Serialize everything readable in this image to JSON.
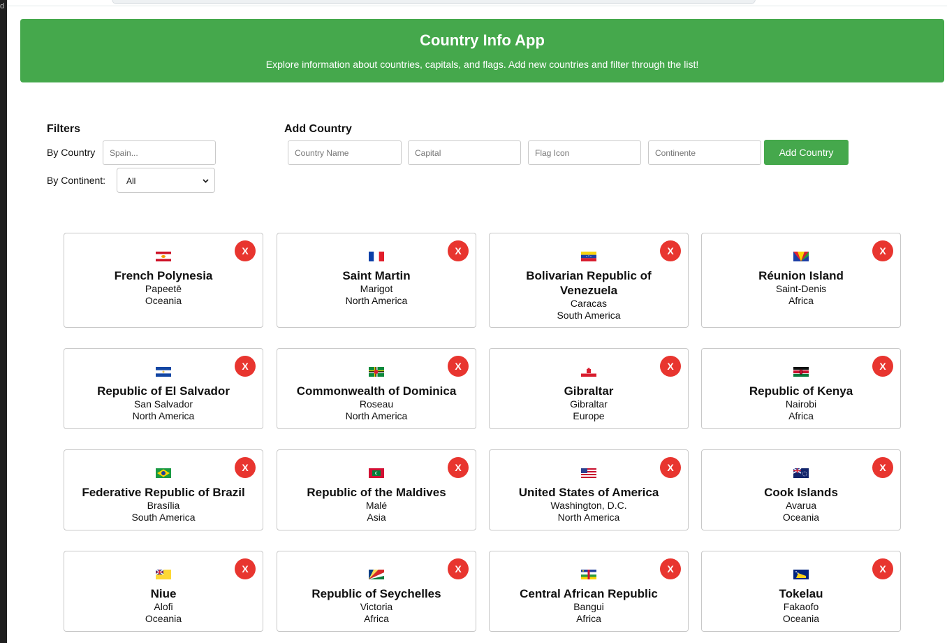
{
  "header": {
    "title": "Country Info App",
    "subtitle": "Explore information about countries, capitals, and flags. Add new countries and filter through the list!"
  },
  "filters": {
    "title": "Filters",
    "by_country_label": "By Country",
    "country_placeholder": "Spain...",
    "by_continent_label": "By Continent:",
    "continent_selected": "All"
  },
  "add_country": {
    "title": "Add Country",
    "name_placeholder": "Country Name",
    "capital_placeholder": "Capital",
    "flag_placeholder": "Flag Icon",
    "continent_placeholder": "Continente",
    "button_label": "Add Country"
  },
  "delete_label": "X",
  "countries": [
    {
      "name": "French Polynesia",
      "capital": "Papeetē",
      "continent": "Oceania",
      "flag_icon": "french-polynesia-flag-icon"
    },
    {
      "name": "Saint Martin",
      "capital": "Marigot",
      "continent": "North America",
      "flag_icon": "saint-martin-flag-icon"
    },
    {
      "name": "Bolivarian Republic of Venezuela",
      "capital": "Caracas",
      "continent": "South America",
      "flag_icon": "venezuela-flag-icon"
    },
    {
      "name": "Réunion Island",
      "capital": "Saint-Denis",
      "continent": "Africa",
      "flag_icon": "reunion-flag-icon"
    },
    {
      "name": "Republic of El Salvador",
      "capital": "San Salvador",
      "continent": "North America",
      "flag_icon": "el-salvador-flag-icon"
    },
    {
      "name": "Commonwealth of Dominica",
      "capital": "Roseau",
      "continent": "North America",
      "flag_icon": "dominica-flag-icon"
    },
    {
      "name": "Gibraltar",
      "capital": "Gibraltar",
      "continent": "Europe",
      "flag_icon": "gibraltar-flag-icon"
    },
    {
      "name": "Republic of Kenya",
      "capital": "Nairobi",
      "continent": "Africa",
      "flag_icon": "kenya-flag-icon"
    },
    {
      "name": "Federative Republic of Brazil",
      "capital": "Brasília",
      "continent": "South America",
      "flag_icon": "brazil-flag-icon"
    },
    {
      "name": "Republic of the Maldives",
      "capital": "Malé",
      "continent": "Asia",
      "flag_icon": "maldives-flag-icon"
    },
    {
      "name": "United States of America",
      "capital": "Washington, D.C.",
      "continent": "North America",
      "flag_icon": "usa-flag-icon"
    },
    {
      "name": "Cook Islands",
      "capital": "Avarua",
      "continent": "Oceania",
      "flag_icon": "cook-islands-flag-icon"
    },
    {
      "name": "Niue",
      "capital": "Alofi",
      "continent": "Oceania",
      "flag_icon": "niue-flag-icon"
    },
    {
      "name": "Republic of Seychelles",
      "capital": "Victoria",
      "continent": "Africa",
      "flag_icon": "seychelles-flag-icon"
    },
    {
      "name": "Central African Republic",
      "capital": "Bangui",
      "continent": "Africa",
      "flag_icon": "central-african-republic-flag-icon"
    },
    {
      "name": "Tokelau",
      "capital": "Fakaofo",
      "continent": "Oceania",
      "flag_icon": "tokelau-flag-icon"
    }
  ]
}
